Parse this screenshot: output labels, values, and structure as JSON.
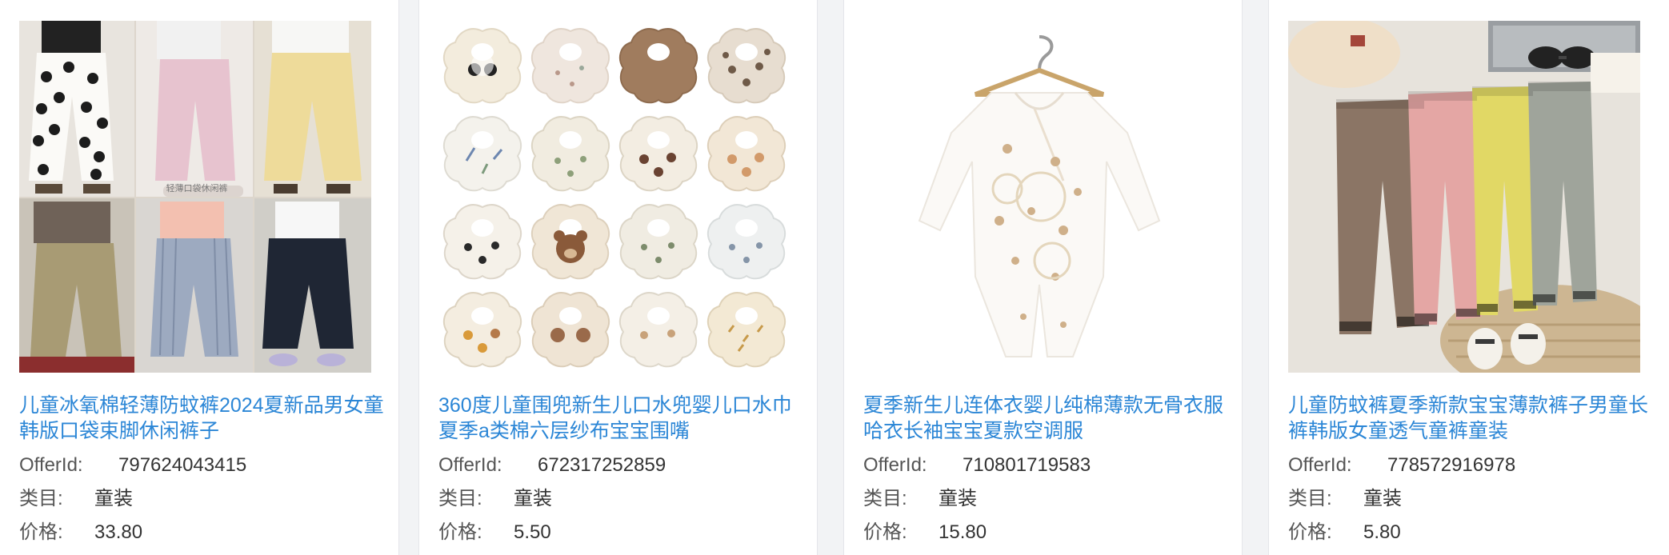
{
  "labels": {
    "offer_id": "OfferId:",
    "category": "类目:",
    "price": "价格:"
  },
  "products": [
    {
      "title": "儿童冰氧棉轻薄防蚊裤2024夏新品男女童韩版口袋束脚休闲裤子",
      "offer_id": "797624043415",
      "category": "童装",
      "price": "33.80",
      "image_icon": "kids-pants-collage-photo",
      "image_caption": "轻薄口袋休闲裤"
    },
    {
      "title": "360度儿童围兜新生儿口水兜婴儿口水巾夏季a类棉六层纱布宝宝围嘴",
      "offer_id": "672317252859",
      "category": "童装",
      "price": "5.50",
      "image_icon": "baby-bibs-grid-photo"
    },
    {
      "title": "夏季新生儿连体衣婴儿纯棉薄款无骨衣服哈衣长袖宝宝夏款空调服",
      "offer_id": "710801719583",
      "category": "童装",
      "price": "15.80",
      "image_icon": "baby-romper-photo"
    },
    {
      "title": "儿童防蚊裤夏季新款宝宝薄款裤子男童长裤韩版女童透气童裤童装",
      "offer_id": "778572916978",
      "category": "童装",
      "price": "5.80",
      "image_icon": "kids-pants-flatlay-photo"
    }
  ],
  "colors": {
    "link": "#2b86d6",
    "text": "#333333",
    "background": "#f2f3f5"
  }
}
